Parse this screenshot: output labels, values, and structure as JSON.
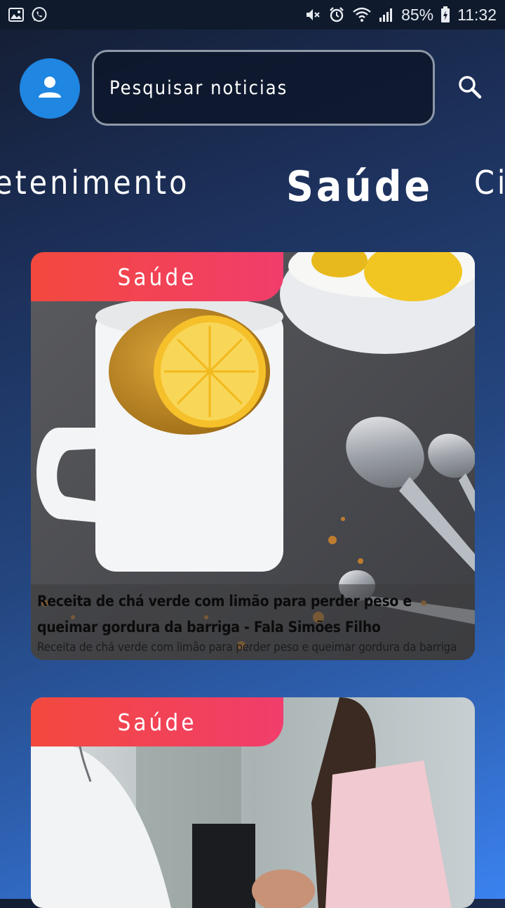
{
  "status_bar": {
    "battery": "85%",
    "time": "11:32"
  },
  "header": {
    "search_placeholder": "Pesquisar noticias"
  },
  "tabs": [
    {
      "label": "Entretenimento"
    },
    {
      "label": "Saúde",
      "active": true
    },
    {
      "label": "Ciência"
    }
  ],
  "tabs_visible": {
    "prev": "retenimento",
    "active": "Saúde",
    "next": "Ci"
  },
  "articles": [
    {
      "category": "Saúde",
      "title": "Receita de chá verde com limão para perder peso e queimar gordura da barriga - Fala Simões Filho",
      "description": "Receita de chá verde com limão para perder peso e queimar gordura da barriga"
    },
    {
      "category": "Saúde"
    }
  ],
  "colors": {
    "accent": "#1f86e2",
    "badge_start": "#f2493e",
    "badge_end": "#f13d6c"
  }
}
